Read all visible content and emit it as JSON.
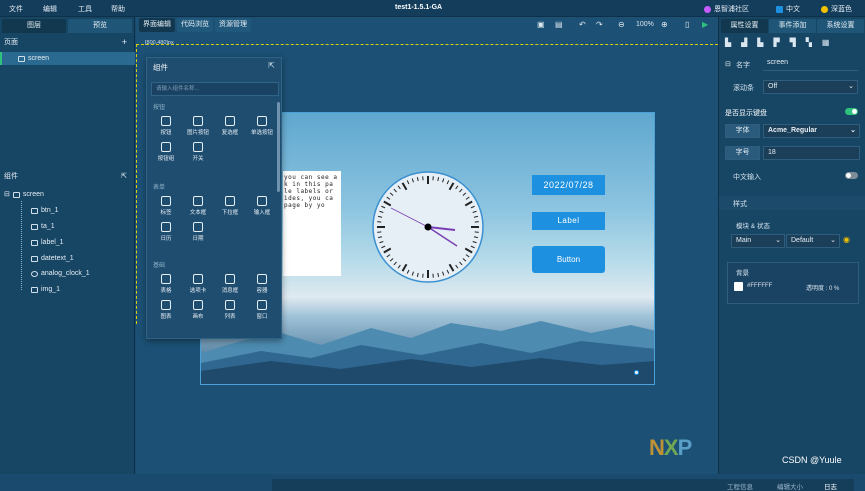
{
  "menubar": {
    "items": [
      "文件",
      "编辑",
      "工具",
      "帮助"
    ],
    "title": "test1-1.5.1-GA",
    "community": "恩智浦社区",
    "language": "中文",
    "theme": "深蓝色"
  },
  "left": {
    "tabs": [
      "图层",
      "预览"
    ],
    "pages_header": "页面",
    "pages": [
      "screen"
    ],
    "components_header": "组件",
    "tree": {
      "root": "screen",
      "children": [
        "btn_1",
        "ta_1",
        "label_1",
        "datetext_1",
        "analog_clock_1",
        "img_1"
      ]
    }
  },
  "center": {
    "tabs": [
      "界面编辑",
      "代码浏览",
      "资源管理"
    ],
    "zoom": "100%",
    "resolution": "[800,480]px",
    "widget_panel": {
      "title": "组件",
      "search_placeholder": "请输入组件名称...",
      "categories": [
        {
          "name": "按钮",
          "items": [
            "按钮",
            "图片按钮",
            "复选框",
            "单选按钮",
            "按钮组",
            "开关"
          ]
        },
        {
          "name": "表单",
          "items": [
            "标签",
            "文本框",
            "下拉框",
            "输入框",
            "日历",
            "日期"
          ]
        },
        {
          "name": "基础",
          "items": [
            "表格",
            "选项卡",
            "消息框",
            "容器",
            "图表",
            "画布",
            "列表",
            "窗口"
          ]
        }
      ]
    },
    "canvas": {
      "textarea": "you can see a k in this pa le labels or ides, you ca page by yo",
      "date": "2022/07/28",
      "label": "Label",
      "button": "Button"
    },
    "status": {
      "project_info": "工程信息",
      "widget_size": "编辑大小",
      "log": "日志"
    }
  },
  "right": {
    "tabs": [
      "属性设置",
      "事件添加",
      "系统设置"
    ],
    "name_label": "名字",
    "name_value": "screen",
    "scroll_label": "滚动条",
    "scroll_value": "Off",
    "keyboard_label": "是否显示键盘",
    "font_label": "字体",
    "font_value": "Acme_Regular",
    "size_label": "字号",
    "size_value": "18",
    "chinese_label": "中文输入",
    "style_header": "样式",
    "part_state_label": "模块 & 状态",
    "part_value": "Main",
    "state_value": "Default",
    "bg_header": "背景",
    "bg_color": "#FFFFFF",
    "opacity_label": "透明度 : 0 %"
  },
  "colors": {
    "accent": "#1e90e0",
    "nxp_orange": "#f7a823",
    "toggle_on": "#2ec27e"
  },
  "watermark": "CSDN @Yuule"
}
